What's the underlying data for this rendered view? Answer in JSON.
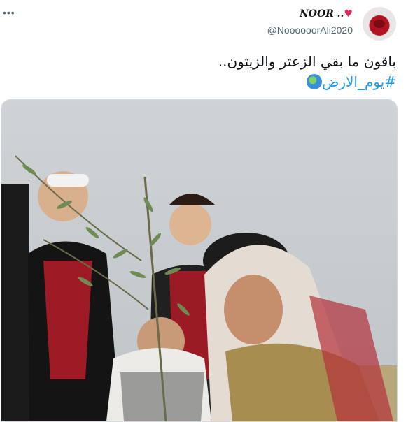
{
  "header": {
    "more_label": "•••"
  },
  "author": {
    "display_name": "NOOR ..",
    "handle": "@NoooooorAli2020"
  },
  "tweet": {
    "text": "باقون ما بقي الزعتر والزيتون..",
    "hashtag": "#يوم_الارض"
  },
  "colors": {
    "accent": "#1d9bf0",
    "heart": "#e0245e"
  },
  "icons": {
    "heart": "heart-icon",
    "globe": "globe-icon"
  }
}
